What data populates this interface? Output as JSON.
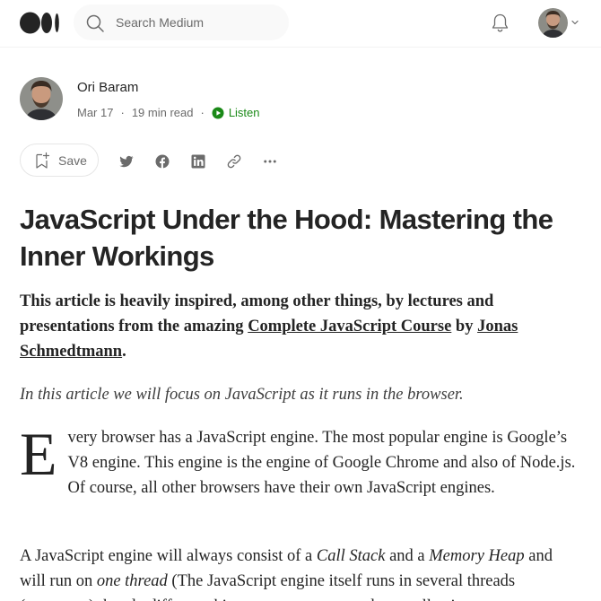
{
  "header": {
    "logo_icon": "medium-logo-icon",
    "search": {
      "placeholder": "Search Medium",
      "icon": "search-icon"
    },
    "notifications_icon": "bell-icon",
    "avatar_icon": "user-avatar",
    "avatar_menu_icon": "chevron-down-icon"
  },
  "author": {
    "name": "Ori Baram",
    "date": "Mar 17",
    "read_time": "19 min read",
    "separator": "·",
    "listen_label": "Listen",
    "listen_icon": "play-circle-icon",
    "accent_color": "#1a8917"
  },
  "actions": {
    "save_label": "Save",
    "share_icons": [
      "twitter-icon",
      "facebook-icon",
      "linkedin-icon",
      "link-icon",
      "more-icon"
    ]
  },
  "article": {
    "title": "JavaScript Under the Hood: Mastering the Inner Workings",
    "intro": {
      "text1": "This article is heavily inspired, among other things, by lectures and presentations from the amazing ",
      "link1": "Complete JavaScript Course",
      "text2": " by ",
      "link2": "Jonas Schmedtmann",
      "text3": "."
    },
    "note": "In this article we will focus on JavaScript as it runs in the browser.",
    "para1": {
      "dropcap": "E",
      "text": "very browser has a JavaScript engine. The most popular engine is Google’s V8 engine. This engine is the engine of Google Chrome and also of Node.js. Of course, all other browsers have their own JavaScript engines."
    },
    "para2": {
      "t1": "A JavaScript engine will always consist of a ",
      "e1": "Call Stack",
      "t2": " and a ",
      "e2": "Memory Heap",
      "t3": " and will run on ",
      "e3": "one thread",
      "t4": " (The JavaScript engine itself runs in several threads (processes) that do different things: compressors, garbage collection etc."
    }
  }
}
